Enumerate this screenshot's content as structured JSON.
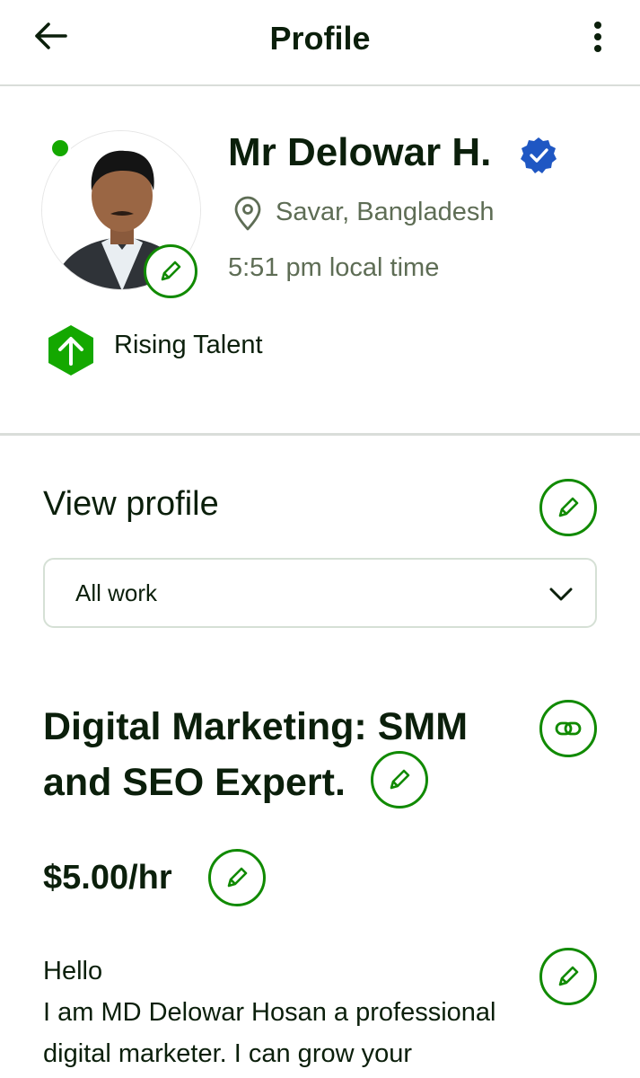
{
  "header": {
    "title": "Profile",
    "back_icon": "arrow-left-icon",
    "more_icon": "more-vertical-icon"
  },
  "profile": {
    "name": "Mr Delowar H.",
    "location": "Savar, Bangladesh",
    "local_time": "5:51 pm local time",
    "badge": "Rising Talent",
    "online": true,
    "verified": true
  },
  "view_profile": {
    "title": "View profile",
    "selected": "All work"
  },
  "job": {
    "title": "Digital Marketing: SMM and SEO Expert.",
    "title_lines": [
      "Digital Marketing: SMM",
      "and SEO Expert."
    ],
    "rate": "$5.00/hr",
    "overview_lines": [
      "Hello",
      "I am MD Delowar Hosan a professional",
      "digital marketer. I can grow your"
    ]
  },
  "colors": {
    "accent_green": "#108a00",
    "online_green": "#14a800",
    "verified_blue": "#1f57c3",
    "text_dark": "#0b1f0b",
    "text_muted": "#5e6d55"
  }
}
